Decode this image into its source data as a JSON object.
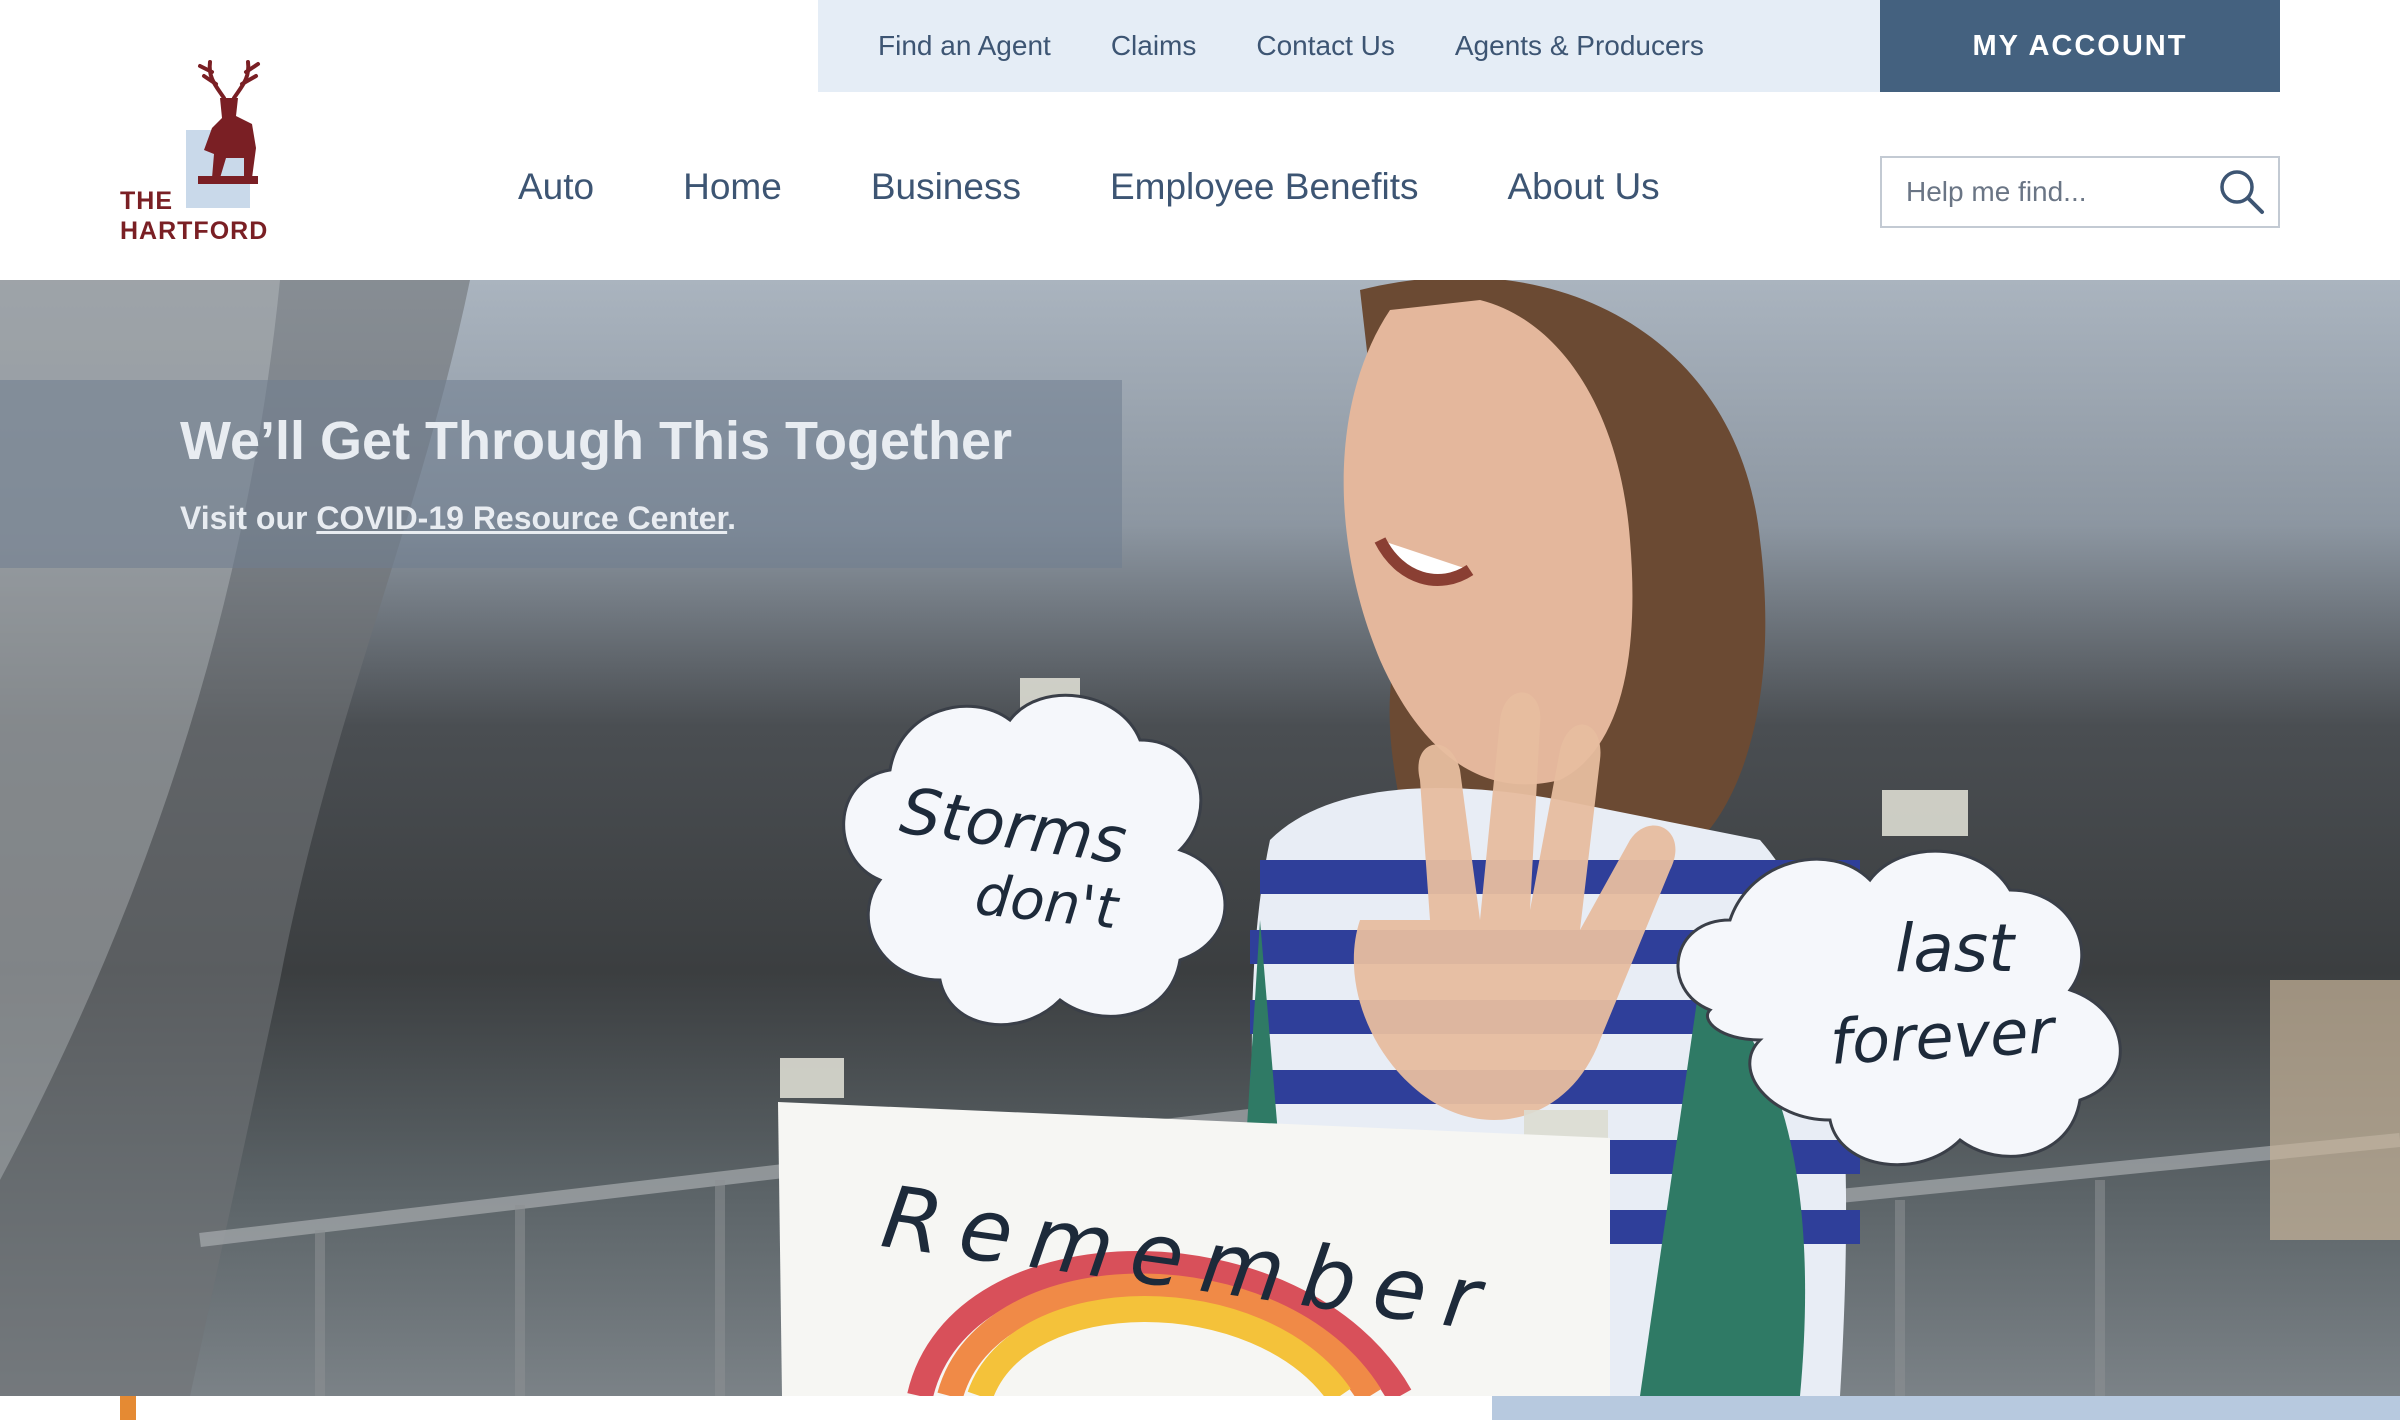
{
  "brand": {
    "line1": "THE",
    "line2": "HARTFORD",
    "color": "#7a1f24"
  },
  "utility_nav": {
    "items": [
      "Find an Agent",
      "Claims",
      "Contact Us",
      "Agents & Producers"
    ],
    "account_label": "MY ACCOUNT"
  },
  "main_nav": {
    "items": [
      "Auto",
      "Home",
      "Business",
      "Employee Benefits",
      "About Us"
    ]
  },
  "search": {
    "placeholder": "Help me find..."
  },
  "hero": {
    "headline": "We’ll Get Through This Together",
    "subtext_prefix": "Visit our ",
    "link_label": "COVID-19 Resource Center",
    "subtext_suffix": ".",
    "signs": {
      "cloud1_line1": "Storms",
      "cloud1_line2": "don't",
      "cloud2_line1": "last",
      "cloud2_line2": "forever",
      "poster": "Remember"
    }
  },
  "colors": {
    "nav_text": "#3d5573",
    "account_bg": "#44617f",
    "utility_bg": "#e5edf6",
    "accent_orange": "#e58a33",
    "accent_blue": "#b7c9df"
  }
}
